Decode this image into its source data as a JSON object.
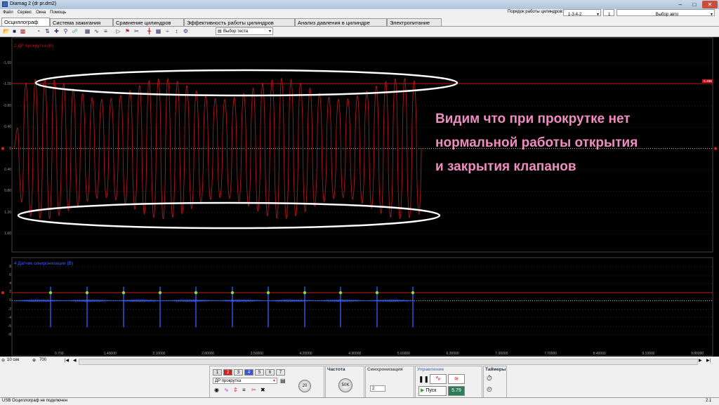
{
  "window": {
    "title": "Diamag 2 (dr pr.dm2)"
  },
  "menu": [
    "Файл",
    "Сервис",
    "Окна",
    "Помощь"
  ],
  "header": {
    "order_label": "Порядок работы цилиндров:",
    "order_value": "1-3-4-2",
    "order_count": "1",
    "auto_select": "Выбор авто"
  },
  "tabs": [
    "Осциллограф",
    "Система зажигания",
    "Сравнение цилиндров",
    "Эффективность работы цилиндров",
    "Анализ давления в цилиндре",
    "Электропитание"
  ],
  "active_tab": 0,
  "toolbar": {
    "test_select": "Выбор теста"
  },
  "plot": {
    "channel1_label": "2 ДР прокрутка (В)",
    "channel1_color": "#b01818",
    "channel1_y_ticks": [
      "-1.60",
      "-1.20",
      "-0.80",
      "-0.40",
      "0",
      "0.40",
      "0.80",
      "1.20",
      "1.60"
    ],
    "cursor_value": "-1.236",
    "channel2_label": "4 Датчик синхронизации (В)",
    "channel2_color": "#3c5cff",
    "channel2_y_ticks": [
      "8",
      "6",
      "4",
      "2",
      "0",
      "-2",
      "-4",
      "-6",
      "-8"
    ],
    "x_ticks": [
      "0.700",
      "1.40000",
      "2.10000",
      "2.80000",
      "3.50000",
      "4.20000",
      "4.90000",
      "5.60000",
      "6.30000",
      "7.00000",
      "7.70000",
      "8.40000",
      "9.10000",
      "9.80000"
    ]
  },
  "annotation": [
    "Видим что при прокрутке нет",
    "нормальной работы открытия",
    "и закрытия клапанов"
  ],
  "bottom": {
    "time_base": "10 сек",
    "points": "700"
  },
  "panel": {
    "channels": [
      "1",
      "2",
      "3",
      "4",
      "5",
      "6",
      "7"
    ],
    "channel_name": "ДР прокрутка",
    "frequency_title": "Частота",
    "frequency_value": "50K",
    "range_value": "20",
    "sync_title": "Синхронизация",
    "sync_value": "2",
    "control_title": "Управление",
    "start_label": "Пуск",
    "rpm_value": "5.79",
    "timers_title": "Таймеры"
  },
  "status": {
    "left": "USB Осциллограф не подключен",
    "right": "2.1"
  }
}
